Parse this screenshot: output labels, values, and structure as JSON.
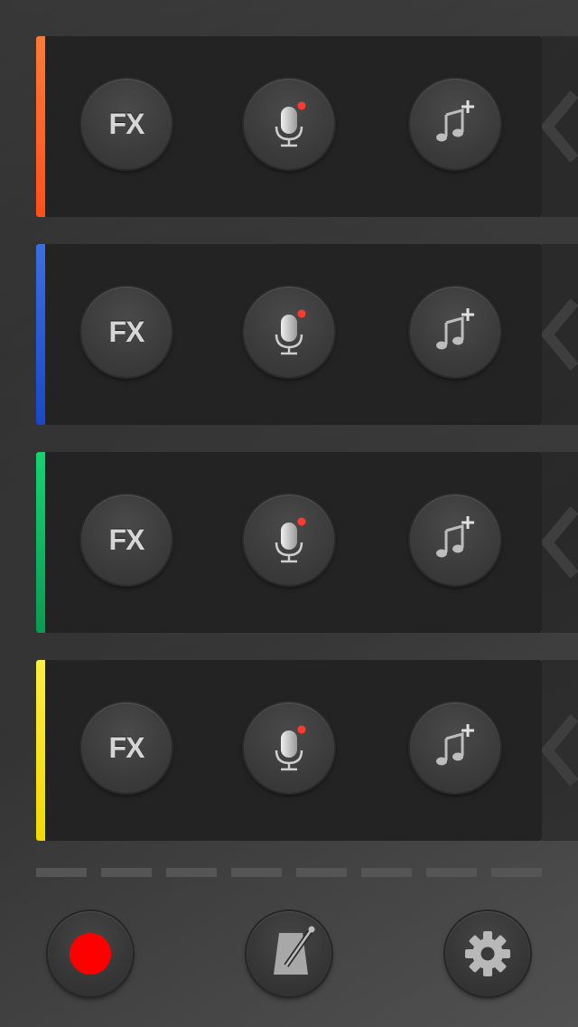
{
  "tracks": [
    {
      "name": "track-1",
      "color": "#ff5a1f",
      "color_top": "#ff7a35",
      "fx_label": "FX",
      "icons": [
        "fx-icon",
        "microphone-icon",
        "add-music-icon"
      ]
    },
    {
      "name": "track-2",
      "color": "#1e4fd0",
      "color_top": "#3a6fe0",
      "fx_label": "FX",
      "icons": [
        "fx-icon",
        "microphone-icon",
        "add-music-icon"
      ]
    },
    {
      "name": "track-3",
      "color": "#0aa85a",
      "color_top": "#15d470",
      "fx_label": "FX",
      "icons": [
        "fx-icon",
        "microphone-icon",
        "add-music-icon"
      ]
    },
    {
      "name": "track-4",
      "color": "#f5e000",
      "color_top": "#ffee40",
      "fx_label": "FX",
      "icons": [
        "fx-icon",
        "microphone-icon",
        "add-music-icon"
      ]
    }
  ],
  "record_indicator_color": "#ff3b30",
  "pager": {
    "segments": 8
  },
  "bottom_bar": {
    "record_button": {
      "icon": "record-icon",
      "color": "#ff0000"
    },
    "metronome_button": {
      "icon": "metronome-icon"
    },
    "settings_button": {
      "icon": "gear-icon"
    }
  }
}
